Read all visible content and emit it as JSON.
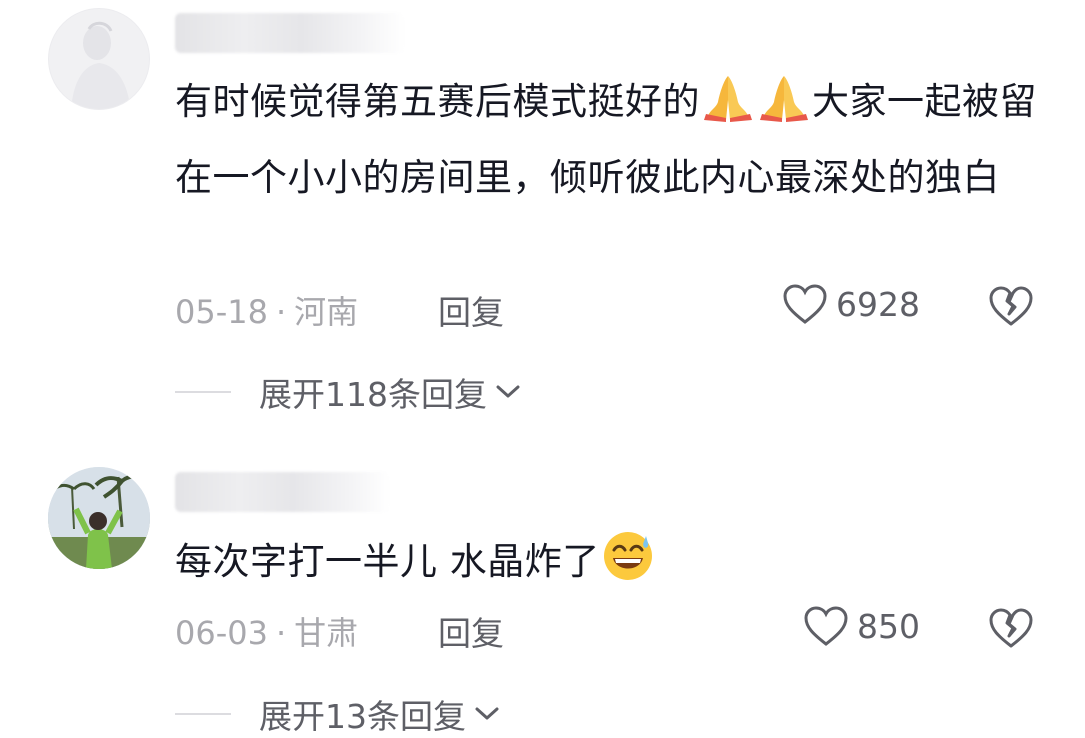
{
  "comments": [
    {
      "text_part1": "有时候觉得第五赛后模式挺好的",
      "text_part2": "大家一起被留在一个小小的房间里，倾听彼此内心最深处的独白",
      "emoji": [
        "folded-hands-icon",
        "folded-hands-icon"
      ],
      "date": "05-18",
      "location": "河南",
      "reply_label": "回复",
      "likes": "6928",
      "expand_label": "展开118条回复"
    },
    {
      "text_part1": "每次字打一半儿 水晶炸了",
      "emoji": [
        "grinning-sweat-face-icon"
      ],
      "date": "06-03",
      "location": "甘肃",
      "reply_label": "回复",
      "likes": "850",
      "expand_label": "展开13条回复"
    }
  ],
  "colors": {
    "text": "#161823",
    "meta": "#a8a8ad",
    "action": "#5e5f66"
  }
}
